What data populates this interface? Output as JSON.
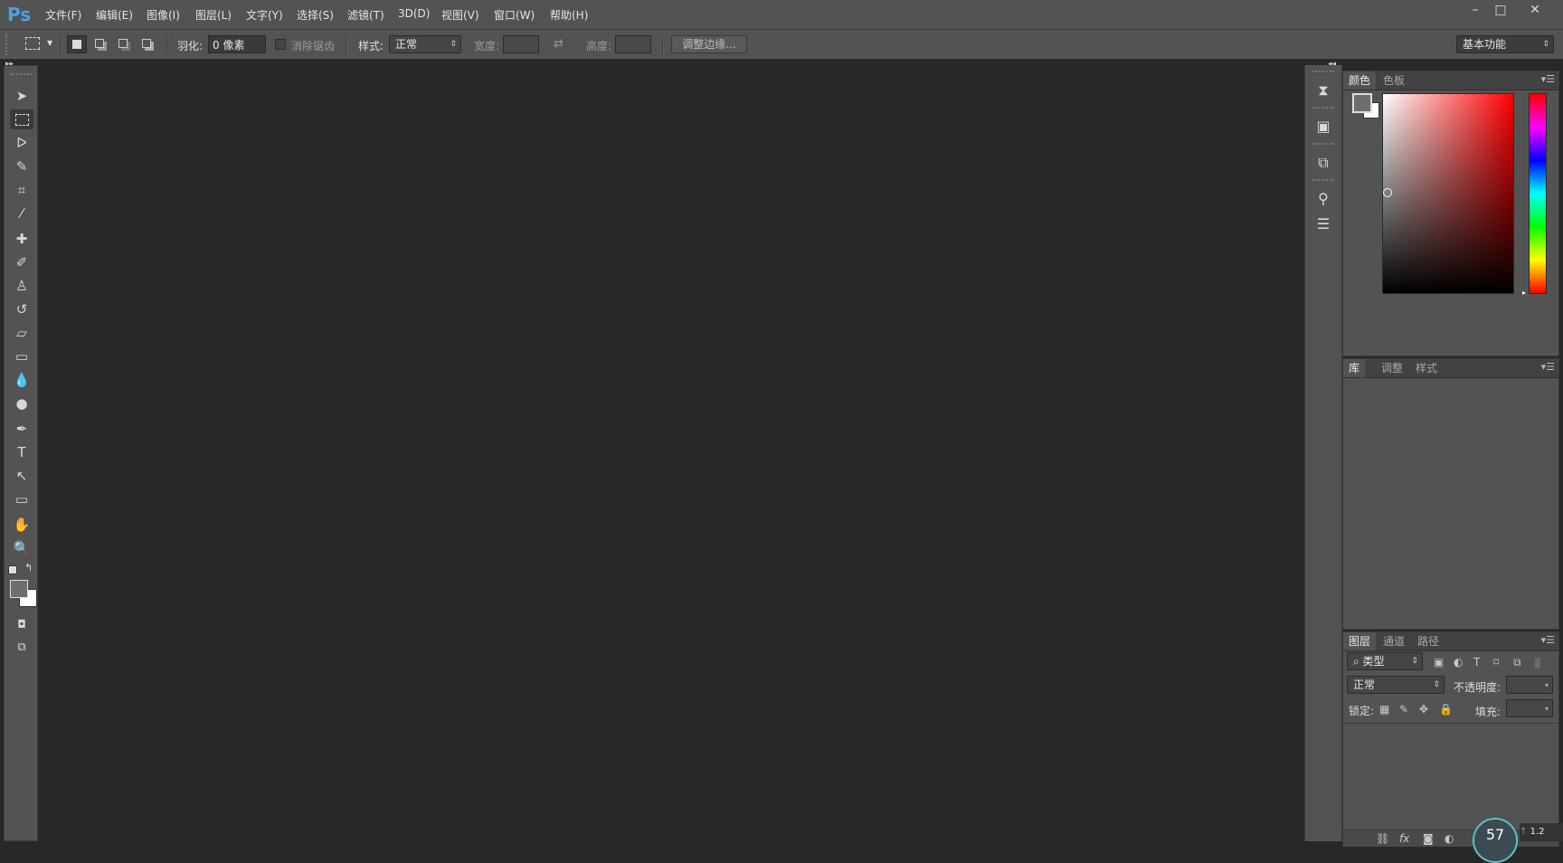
{
  "app": {
    "logo": "Ps"
  },
  "menu": [
    "文件(F)",
    "编辑(E)",
    "图像(I)",
    "图层(L)",
    "文字(Y)",
    "选择(S)",
    "滤镜(T)",
    "3D(D)",
    "视图(V)",
    "窗口(W)",
    "帮助(H)"
  ],
  "window_controls": {
    "minimize": "–",
    "maximize": "□",
    "close": "✕"
  },
  "options": {
    "feather_label": "羽化:",
    "feather_value": "0 像素",
    "antialias_label": "消除锯齿",
    "style_label": "样式:",
    "style_value": "正常",
    "width_label": "宽度:",
    "height_label": "高度:",
    "refine_edge_button": "调整边缘...",
    "workspace_value": "基本功能"
  },
  "color_panel": {
    "tabs": [
      "颜色",
      "色板"
    ],
    "foreground": "#6e6e6e",
    "background": "#ffffff",
    "hue_color": "#ff0000"
  },
  "libraries_panel": {
    "tabs": [
      "库",
      "调整",
      "样式"
    ]
  },
  "layers_panel": {
    "tabs": [
      "图层",
      "通道",
      "路径"
    ],
    "filter_value": "类型",
    "blend_mode": "正常",
    "opacity_label": "不透明度:",
    "lock_label": "锁定:",
    "fill_label": "填充:"
  },
  "status_widget": {
    "percent": "57",
    "net_speed": "1.2"
  }
}
